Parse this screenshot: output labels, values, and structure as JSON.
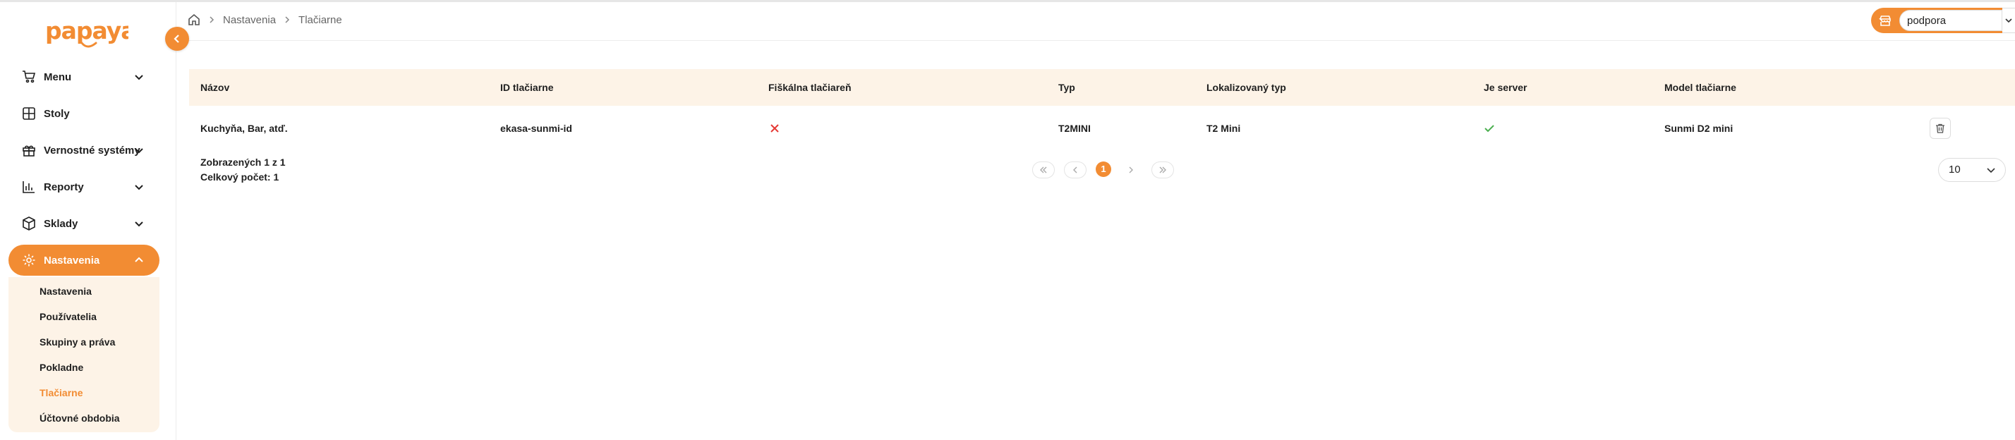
{
  "app": {
    "logo_text": "papaya"
  },
  "colors": {
    "accent": "#f28c33",
    "accent_light": "#fdf3e7",
    "success": "#4caf50",
    "danger": "#e53935"
  },
  "sidebar": {
    "items": [
      {
        "label": "Menu",
        "icon": "cart-icon",
        "has_chevron": true
      },
      {
        "label": "Stoly",
        "icon": "grid-icon",
        "has_chevron": false
      },
      {
        "label": "Vernostné systémy",
        "icon": "gift-icon",
        "has_chevron": true
      },
      {
        "label": "Reporty",
        "icon": "bar-chart-icon",
        "has_chevron": true
      },
      {
        "label": "Sklady",
        "icon": "box-icon",
        "has_chevron": true
      },
      {
        "label": "Nastavenia",
        "icon": "gear-icon",
        "has_chevron": true,
        "active": true
      }
    ],
    "submenu": [
      {
        "label": "Nastavenia"
      },
      {
        "label": "Používatelia"
      },
      {
        "label": "Skupiny a práva"
      },
      {
        "label": "Pokladne"
      },
      {
        "label": "Tlačiarne",
        "active": true
      },
      {
        "label": "Účtovné obdobia"
      }
    ]
  },
  "breadcrumb": {
    "items": [
      "Nastavenia",
      "Tlačiarne"
    ]
  },
  "store_select": {
    "value": "podpora"
  },
  "table": {
    "columns": [
      "Názov",
      "ID tlačiarne",
      "Fiškálna tlačiareň",
      "Typ",
      "Lokalizovaný typ",
      "Je server",
      "Model tlačiarne"
    ],
    "rows": [
      {
        "name": "Kuchyňa, Bar, atď.",
        "printer_id": "ekasa-sunmi-id",
        "fiscal": false,
        "type": "T2MINI",
        "localized_type": "T2 Mini",
        "is_server": true,
        "model": "Sunmi D2 mini"
      }
    ]
  },
  "footer": {
    "shown": "Zobrazených 1 z 1",
    "total": "Celkový počet: 1",
    "current_page": "1",
    "page_size": "10"
  }
}
